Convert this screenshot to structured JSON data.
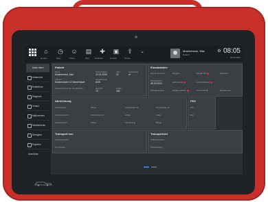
{
  "topbar": {
    "icons": [
      {
        "name": "home-icon",
        "label": "Einsätze"
      },
      {
        "name": "clock-icon",
        "label": "Zeiten"
      },
      {
        "name": "person-icon",
        "label": "Patient"
      },
      {
        "name": "doc-icon",
        "label": "Doku"
      },
      {
        "name": "med-icon",
        "label": "Medikation"
      },
      {
        "name": "protocol-icon",
        "label": "Protokoll"
      },
      {
        "name": "send-icon",
        "label": "Senden"
      }
    ],
    "user_name": "Mustermann, Max",
    "user_role": "Notarzt",
    "time": "08:05",
    "date": "08.03.2021"
  },
  "sidebar": {
    "items": [
      {
        "label": "Basis-daten",
        "active": true
      },
      {
        "label": "Anamnese",
        "active": false
      },
      {
        "label": "Erstbefund",
        "active": false
      },
      {
        "label": "Diagnose",
        "active": false
      },
      {
        "label": "Verlauf",
        "active": false
      },
      {
        "label": "Maßnahmen",
        "active": false
      },
      {
        "label": "Medikamente",
        "active": false
      },
      {
        "label": "Übergabe",
        "active": false
      },
      {
        "label": "Ergebnis",
        "active": false
      },
      {
        "label": "Abschluss",
        "active": false
      }
    ]
  },
  "patient": {
    "title": "Patient",
    "f_name": "Name",
    "v_name": "Mustermann, Max",
    "f_dob": "Geburtsdatum",
    "v_dob": "10.01.2000",
    "f_age": "Alter",
    "v_age": "21",
    "f_sex": "Geschlecht",
    "v_sex": "m",
    "f_address": "Adresse",
    "v_address": "Musterstraße 12 Musterstadt",
    "f_insurance": "Versicherung",
    "v_insurance": "AOK",
    "f_weight": "Gewicht",
    "v_weight": "75",
    "f_height": "Größe",
    "v_height": "180",
    "f_phone": "Telefonnummer der Angehörigen"
  },
  "einsatz": {
    "title": "Einsatzdaten",
    "f1": "Einsatz-Nummer",
    "v1": "Eingabe",
    "f2": "Einsatz Ort",
    "f3": "Einsatzart",
    "f4": "Einsatzdatum",
    "v4": "08.03.2021",
    "f5": "Alarmierung",
    "f6": "Ankunft Patient",
    "f7": "Einsatzergebnis",
    "v7": "Eingabe wählen",
    "f8": "Ankunft Klinik",
    "f9": "Einsatzende"
  },
  "abrechnung": {
    "title": "Abrechnung",
    "f1": "Kostenträger",
    "f2": "Status",
    "f3": "Kostenträger Nr.",
    "f4": "Kostenträger Nr.",
    "f5": "Versicherten-Nr.",
    "f6": "Versicherten Nr.",
    "f7": "Gültig",
    "f8": "Gültig",
    "f9": "Rechnungsart",
    "f10": "Status",
    "f11": "Abrechnung",
    "f12": "Betrag"
  },
  "fdc": {
    "title": "FDC",
    "f1": "Ziel",
    "f2": "Zeit"
  },
  "transport_von": {
    "title": "Transport von",
    "f1": "Transportbeginn",
    "f2": "Ort Adresse"
  },
  "transportziel": {
    "title": "Transportziel",
    "f1": "Zielkrankenhaus",
    "f2": "Fachabteilung"
  },
  "branding": {
    "logo": "fire-truck-logo"
  }
}
